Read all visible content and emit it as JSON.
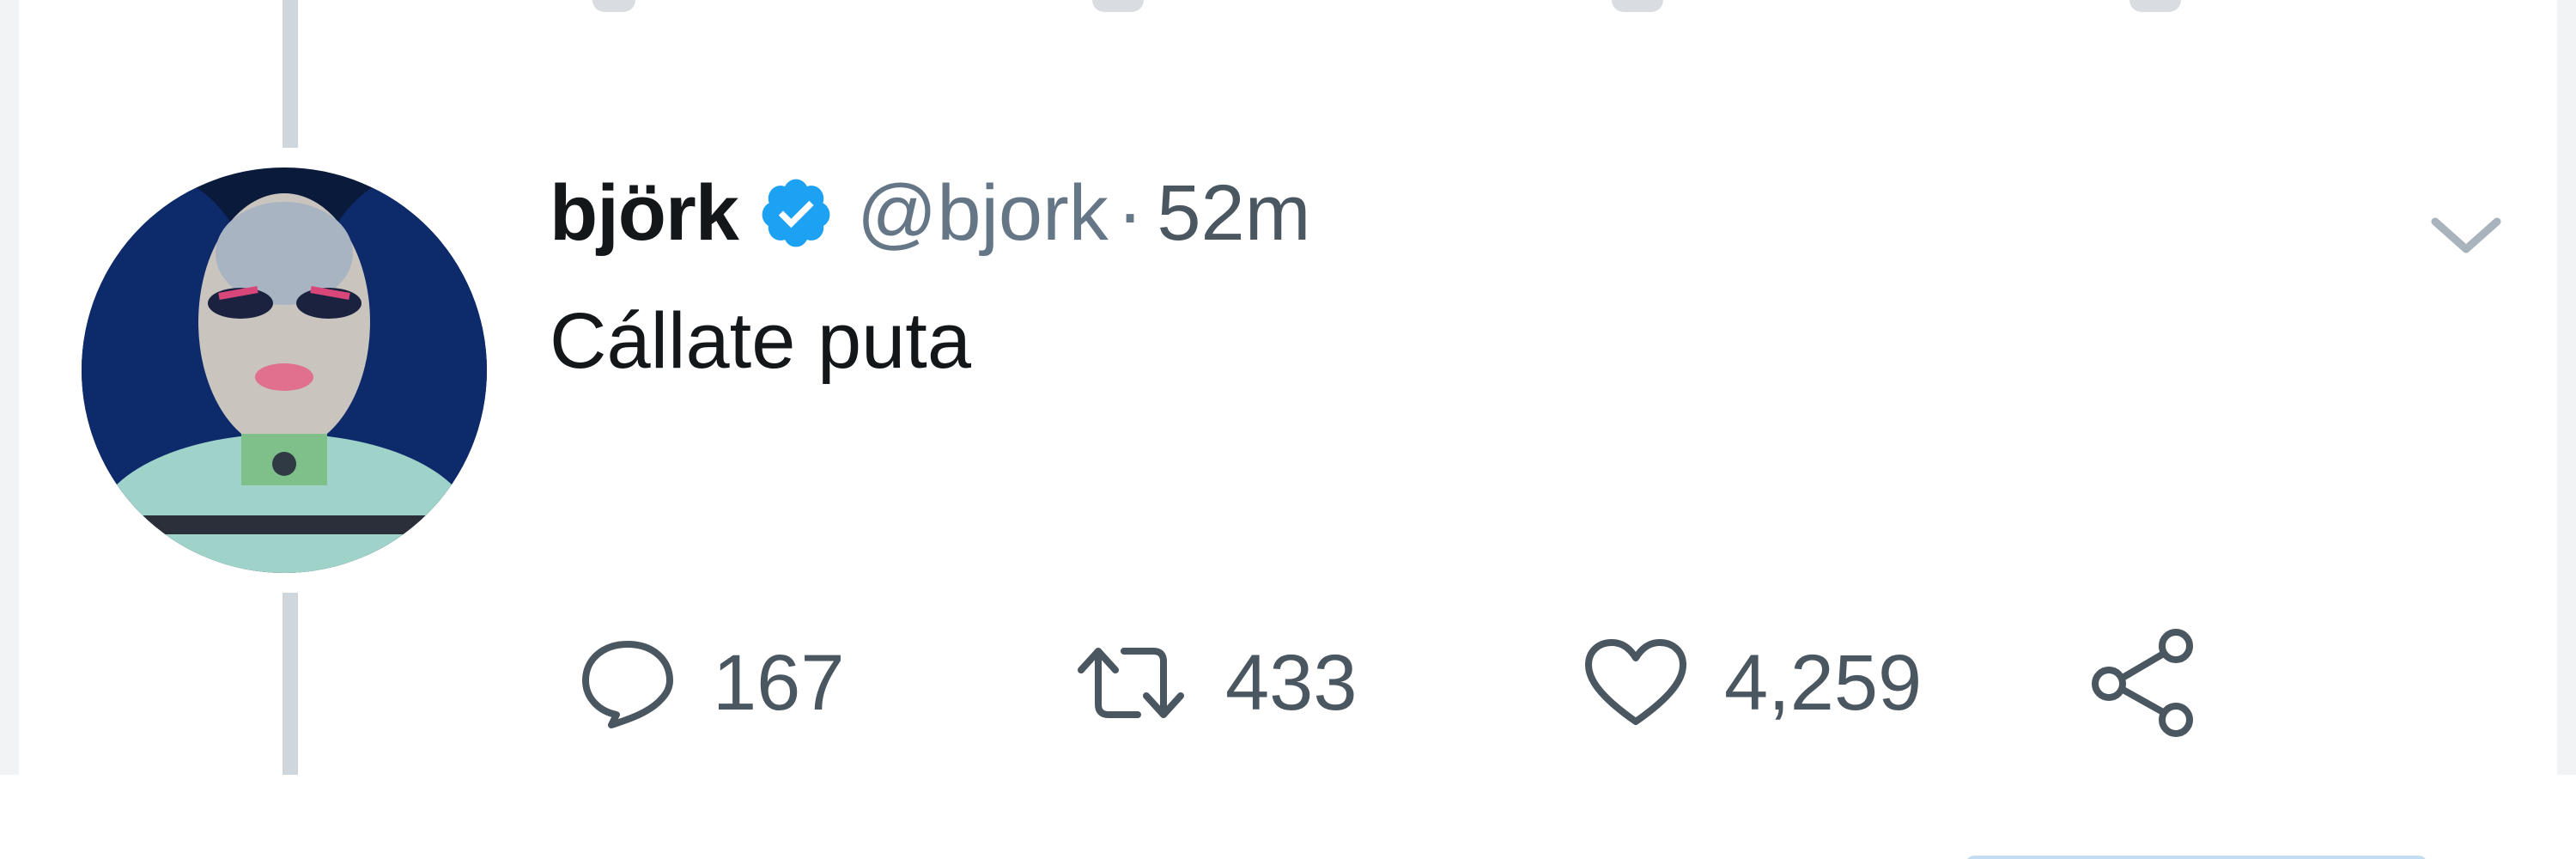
{
  "tweet": {
    "display_name": "björk",
    "verified": true,
    "handle": "@bjork",
    "separator": "·",
    "time": "52m",
    "text": "Cállate puta",
    "avatar_icon": "avatar-image",
    "menu_icon": "chevron-down-icon"
  },
  "actions": {
    "reply_count": "167",
    "retweet_count": "433",
    "like_count": "4,259",
    "reply_icon": "comment-icon",
    "retweet_icon": "retweet-icon",
    "like_icon": "heart-icon",
    "share_icon": "share-icon"
  },
  "colors": {
    "verified_blue": "#1da1f2",
    "text_primary": "#14171a",
    "text_secondary": "#657786",
    "thread_line": "#cfd6dc",
    "gutter": "#f1f3f5"
  }
}
